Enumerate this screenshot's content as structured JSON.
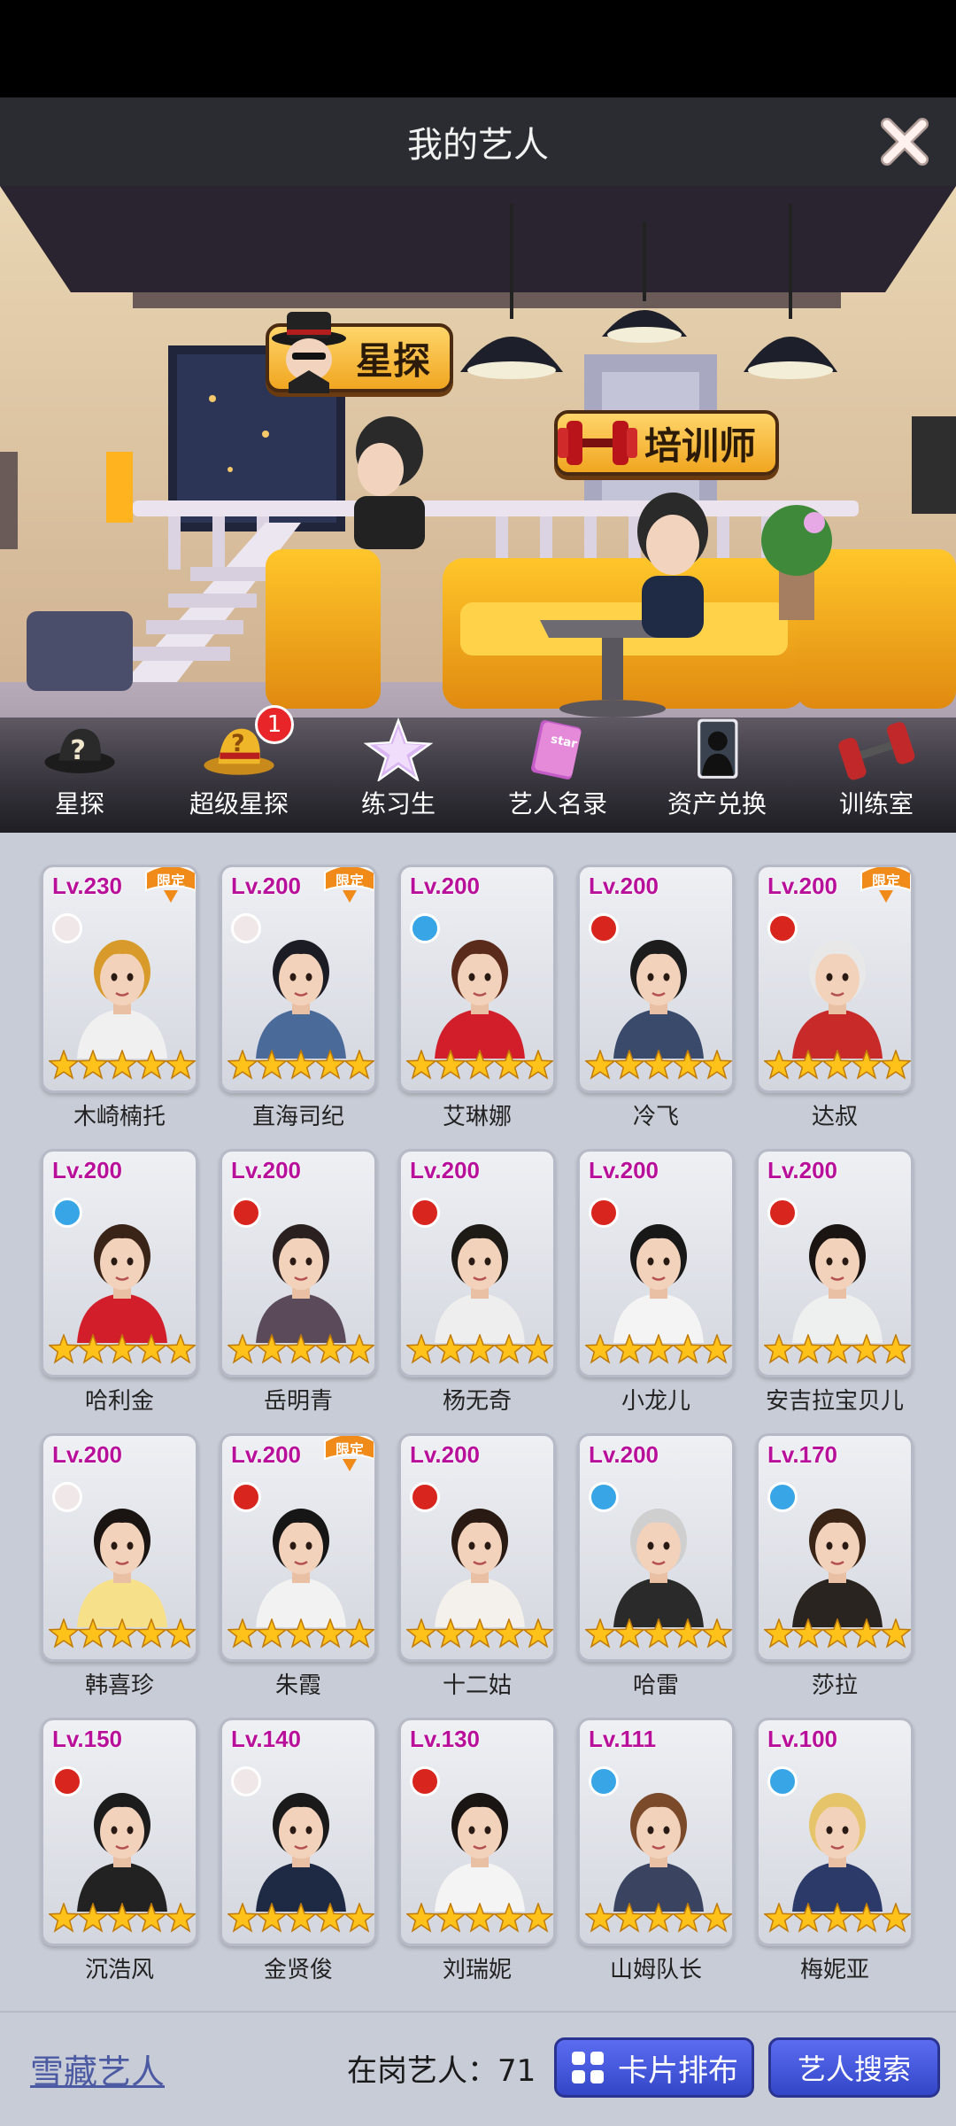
{
  "header": {
    "title": "我的艺人"
  },
  "scene": {
    "scout_sign": "星探",
    "trainer_sign": "培训师"
  },
  "iconbar": {
    "items": [
      {
        "label": "星探",
        "icon": "hat-icon"
      },
      {
        "label": "超级星探",
        "icon": "golden-hat-icon",
        "badge": "1"
      },
      {
        "label": "练习生",
        "icon": "star-icon"
      },
      {
        "label": "艺人名录",
        "icon": "book-icon"
      },
      {
        "label": "资产兑换",
        "icon": "silhouette-card-icon"
      },
      {
        "label": "训练室",
        "icon": "dumbbell-icon"
      }
    ]
  },
  "limited_label": "限定",
  "artists": [
    {
      "level": "Lv.230",
      "name": "木崎楠托",
      "element": "white",
      "limited": true,
      "stars": 5
    },
    {
      "level": "Lv.200",
      "name": "直海司纪",
      "element": "white",
      "limited": true,
      "stars": 5
    },
    {
      "level": "Lv.200",
      "name": "艾琳娜",
      "element": "blue",
      "limited": false,
      "stars": 5
    },
    {
      "level": "Lv.200",
      "name": "冷飞",
      "element": "red",
      "limited": false,
      "stars": 5
    },
    {
      "level": "Lv.200",
      "name": "达叔",
      "element": "red",
      "limited": true,
      "stars": 5
    },
    {
      "level": "Lv.200",
      "name": "哈利金",
      "element": "blue",
      "limited": false,
      "stars": 5
    },
    {
      "level": "Lv.200",
      "name": "岳明青",
      "element": "red",
      "limited": false,
      "stars": 5
    },
    {
      "level": "Lv.200",
      "name": "杨无奇",
      "element": "red",
      "limited": false,
      "stars": 5
    },
    {
      "level": "Lv.200",
      "name": "小龙儿",
      "element": "red",
      "limited": false,
      "stars": 5
    },
    {
      "level": "Lv.200",
      "name": "安吉拉宝贝儿",
      "element": "red",
      "limited": false,
      "stars": 5
    },
    {
      "level": "Lv.200",
      "name": "韩喜珍",
      "element": "white",
      "limited": false,
      "stars": 5
    },
    {
      "level": "Lv.200",
      "name": "朱霞",
      "element": "red",
      "limited": true,
      "stars": 5
    },
    {
      "level": "Lv.200",
      "name": "十二姑",
      "element": "red",
      "limited": false,
      "stars": 5
    },
    {
      "level": "Lv.200",
      "name": "哈雷",
      "element": "blue",
      "limited": false,
      "stars": 5
    },
    {
      "level": "Lv.170",
      "name": "莎拉",
      "element": "blue",
      "limited": false,
      "stars": 5
    },
    {
      "level": "Lv.150",
      "name": "沉浩风",
      "element": "red",
      "limited": false,
      "stars": 5
    },
    {
      "level": "Lv.140",
      "name": "金贤俊",
      "element": "white",
      "limited": false,
      "stars": 5
    },
    {
      "level": "Lv.130",
      "name": "刘瑞妮",
      "element": "red",
      "limited": false,
      "stars": 5
    },
    {
      "level": "Lv.111",
      "name": "山姆队长",
      "element": "blue",
      "limited": false,
      "stars": 5
    },
    {
      "level": "Lv.100",
      "name": "梅妮亚",
      "element": "blue",
      "limited": false,
      "stars": 5
    }
  ],
  "footer": {
    "hidden_artists": "雪藏艺人",
    "active_count": "在岗艺人：71",
    "card_layout_button": "卡片排布",
    "search_button": "艺人搜索"
  },
  "colors": {
    "level_text": "#b8109a",
    "button_blue": "#3346c8",
    "sign_gold": "#f0a620"
  }
}
